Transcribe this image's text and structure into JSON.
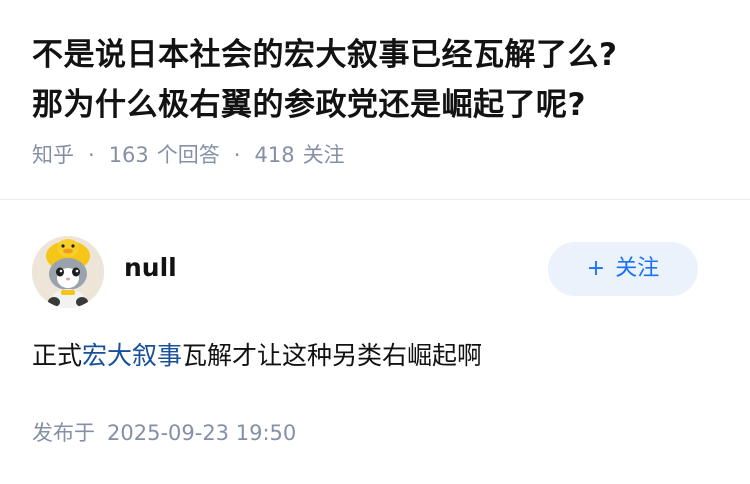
{
  "question": {
    "title_line1": "不是说日本社会的宏大叙事已经瓦解了么?",
    "title_line2": "那为什么极右翼的参政党还是崛起了呢?",
    "source": "知乎",
    "answer_count": "163",
    "answer_label": "个回答",
    "follower_count": "418",
    "follower_label": "关注",
    "separator": "·"
  },
  "answer": {
    "author_name": "null",
    "follow_label": "关注",
    "follow_plus": "+",
    "content_before": "正式",
    "content_link": "宏大叙事",
    "content_after": "瓦解才让这种另类右崛起啊",
    "published_label": "发布于",
    "published_time": "2025-09-23 19:50"
  },
  "icons": {
    "avatar": "cat-in-yellow-duck-hat-avatar"
  },
  "colors": {
    "accent": "#1772f6",
    "link": "#175199",
    "meta_text": "#8590a6",
    "follow_bg": "#ebf2fb"
  }
}
